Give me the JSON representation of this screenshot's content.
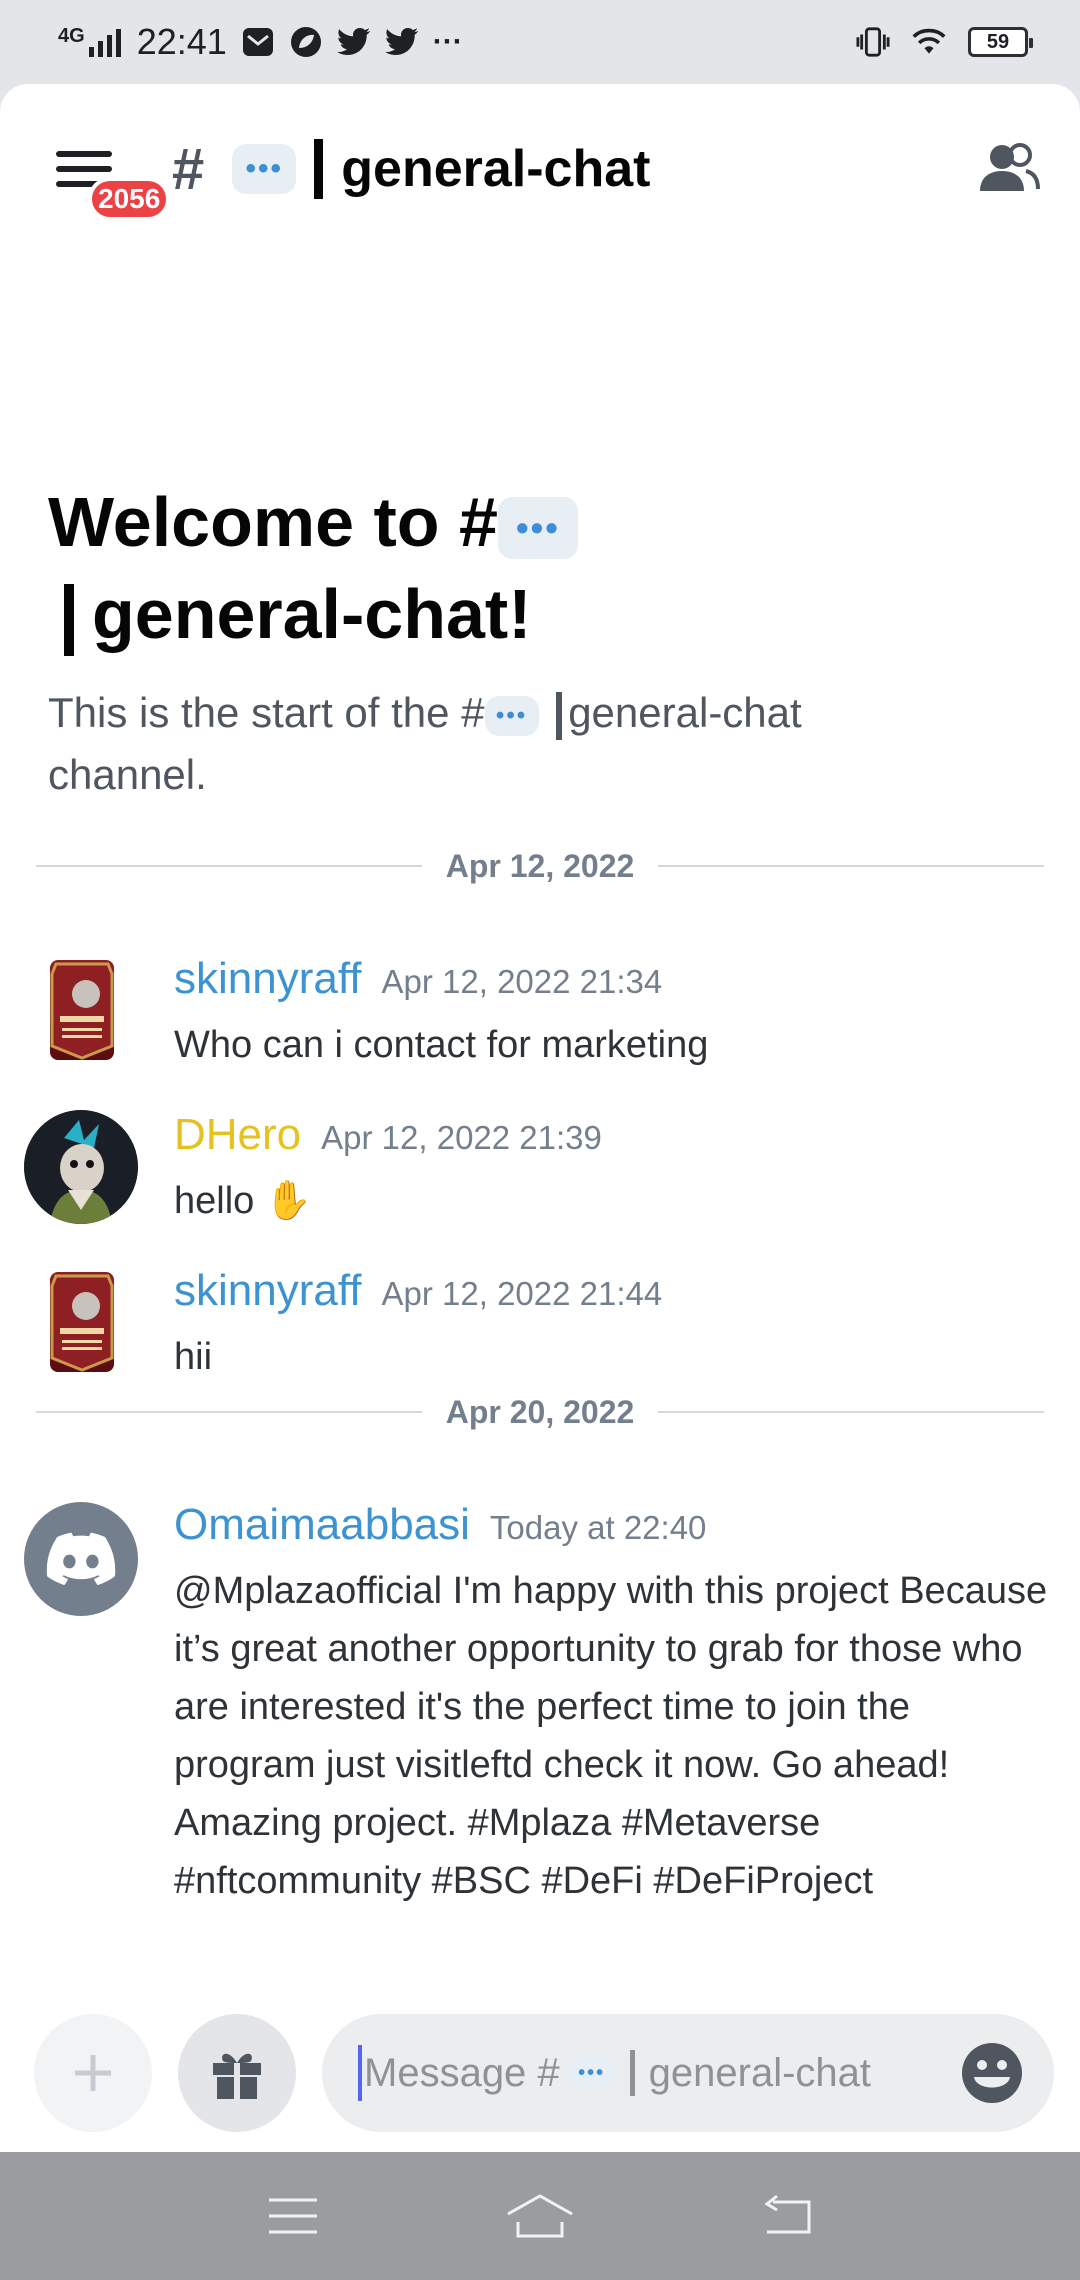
{
  "status_bar": {
    "network": "4G",
    "time": "22:41",
    "more": "···",
    "battery": "59"
  },
  "header": {
    "unread_badge": "2056",
    "hash": "#",
    "channel_name": "general-chat"
  },
  "welcome": {
    "title_prefix": "Welcome to #",
    "title_channel": "general-chat!",
    "subtitle_prefix": "This is the start of the #",
    "subtitle_channel": "general-chat",
    "subtitle_suffix": "channel."
  },
  "dividers": [
    {
      "label": "Apr 12, 2022"
    },
    {
      "label": "Apr 20, 2022"
    }
  ],
  "messages": [
    {
      "username": "skinnyraff",
      "timestamp": "Apr 12, 2022 21:34",
      "text": "Who can i contact for marketing",
      "name_color": "#3d93d1"
    },
    {
      "username": "DHero",
      "timestamp": "Apr 12, 2022 21:39",
      "text": "hello",
      "emoji": "✋",
      "name_color": "#e6c220"
    },
    {
      "username": "skinnyraff",
      "timestamp": "Apr 12, 2022 21:44",
      "text": "hii",
      "name_color": "#3d93d1"
    },
    {
      "username": "Omaimaabbasi",
      "timestamp": "Today at 22:40",
      "text": "@Mplazaofficial I'm happy with this project Because it’s  great another opportunity to grab for those who are interested it's the perfect time to join the program just visitleftd check it now. Go ahead! Amazing project. #Mplaza #Metaverse #nftcommunity #BSC  #DeFi #DeFiProject",
      "name_color": "#3d93d1"
    }
  ],
  "composer": {
    "placeholder_prefix": "Message #",
    "placeholder_channel": "general-chat"
  },
  "icons": {
    "menu": "hamburger-icon",
    "members": "members-icon",
    "attach": "plus-icon",
    "gift": "gift-icon",
    "emoji": "emoji-icon",
    "nav_menu": "menu-icon",
    "nav_home": "home-icon",
    "nav_back": "back-icon"
  },
  "colors": {
    "accent": "#5865f2",
    "badge": "#ed4245",
    "link_name": "#3d93d1",
    "gold_name": "#e6c220"
  }
}
